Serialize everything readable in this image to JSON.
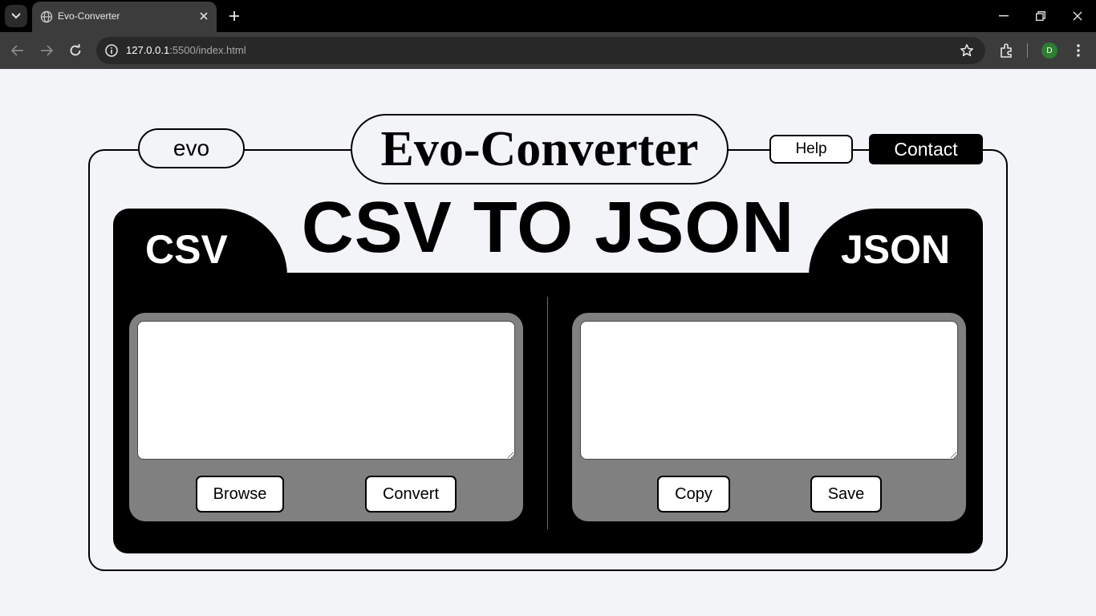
{
  "browser": {
    "tab_title": "Evo-Converter",
    "url_host": "127.0.0.1",
    "url_path": ":5500/index.html",
    "profile_initial": "D",
    "profile_color": "#2e7d32"
  },
  "header": {
    "logo": "evo",
    "title": "Evo-Converter",
    "help_label": "Help",
    "contact_label": "Contact"
  },
  "main": {
    "headline": "CSV TO JSON",
    "csv_tab_label": "CSV",
    "json_tab_label": "JSON",
    "csv_input_value": "",
    "json_output_value": "",
    "browse_label": "Browse",
    "convert_label": "Convert",
    "copy_label": "Copy",
    "save_label": "Save"
  },
  "colors": {
    "page_background": "#f3f4f8",
    "panel": "#000000",
    "editor_box": "#808080"
  }
}
